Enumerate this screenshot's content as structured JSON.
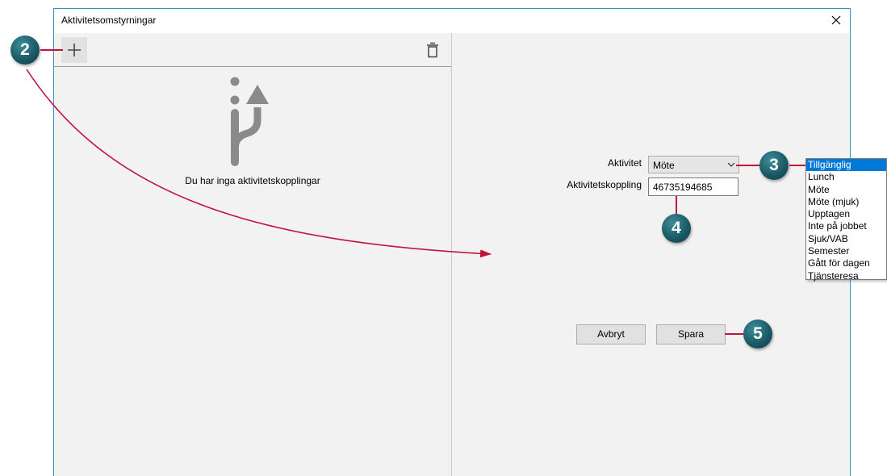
{
  "window": {
    "title": "Aktivitetsomstyrningar"
  },
  "left_pane": {
    "empty_message": "Du har inga aktivitetskopplingar"
  },
  "form": {
    "activity_label": "Aktivitet",
    "activity_value": "Möte",
    "link_label": "Aktivitetskoppling",
    "link_value": "46735194685",
    "cancel_label": "Avbryt",
    "save_label": "Spara"
  },
  "dropdown": {
    "options": [
      "Tillgänglig",
      "Lunch",
      "Möte",
      "Möte (mjuk)",
      "Upptagen",
      "Inte på jobbet",
      "Sjuk/VAB",
      "Semester",
      "Gått för dagen",
      "Tjänsteresa"
    ],
    "selected": "Tillgänglig"
  },
  "callouts": {
    "add": "2",
    "dropdown": "3",
    "textbox": "4",
    "save": "5"
  },
  "colors": {
    "accent": "#0078d7",
    "annotation_line": "#c0143c",
    "callout": "#1b5a67",
    "window_border": "#3b8fc4"
  }
}
